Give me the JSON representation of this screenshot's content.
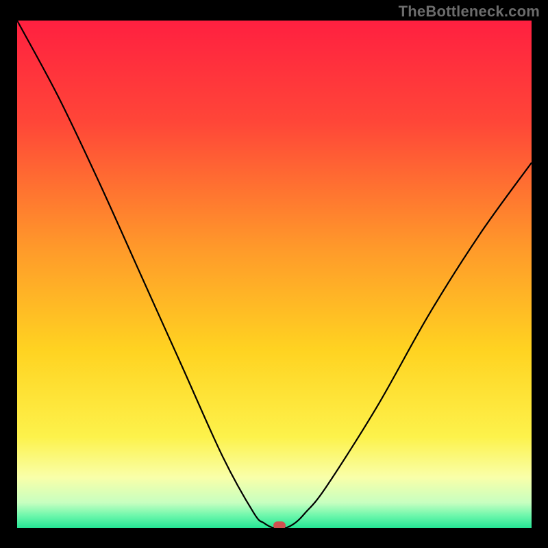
{
  "watermark": "TheBottleneck.com",
  "colors": {
    "background_frame": "#000000",
    "curve_stroke": "#000000",
    "marker_fill": "#d05050",
    "gradient_stops": [
      {
        "offset": 0.0,
        "color": "#ff2040"
      },
      {
        "offset": 0.2,
        "color": "#ff4638"
      },
      {
        "offset": 0.45,
        "color": "#ff9a2a"
      },
      {
        "offset": 0.65,
        "color": "#ffd321"
      },
      {
        "offset": 0.82,
        "color": "#fdf24b"
      },
      {
        "offset": 0.9,
        "color": "#f9ffa9"
      },
      {
        "offset": 0.95,
        "color": "#c7ffc0"
      },
      {
        "offset": 0.975,
        "color": "#6ef7ac"
      },
      {
        "offset": 1.0,
        "color": "#24e594"
      }
    ]
  },
  "chart_data": {
    "type": "line",
    "title": "",
    "xlabel": "",
    "ylabel": "",
    "xlim": [
      0,
      100
    ],
    "ylim": [
      0,
      100
    ],
    "x": [
      0,
      8,
      16,
      24,
      32,
      40,
      46,
      48,
      50,
      52,
      54,
      56,
      60,
      70,
      80,
      90,
      100
    ],
    "values": [
      100,
      85,
      68,
      50,
      32,
      14,
      3,
      1,
      0,
      0,
      1,
      3,
      8,
      24,
      42,
      58,
      72
    ],
    "marker": {
      "x": 51,
      "y": 0.5
    }
  }
}
